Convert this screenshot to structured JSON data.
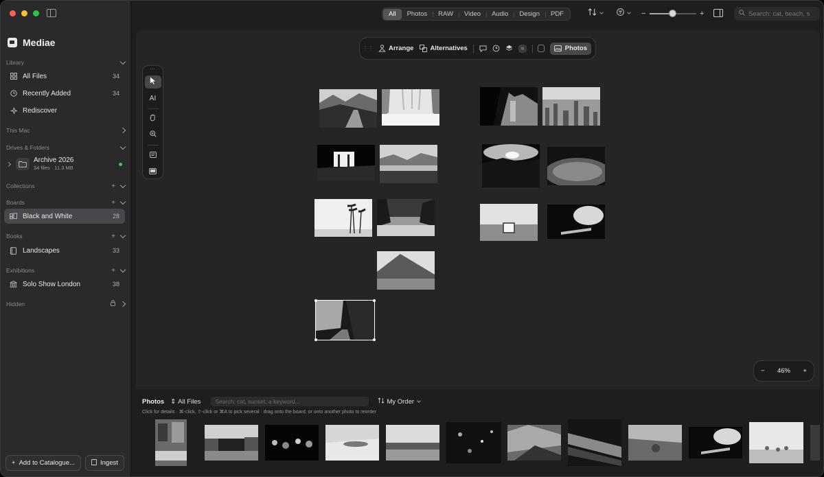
{
  "app": {
    "name": "Mediae"
  },
  "topbar": {
    "filter_tabs": [
      "All",
      "Photos",
      "RAW",
      "Video",
      "Audio",
      "Design",
      "PDF"
    ],
    "selected_filter": "All",
    "search_placeholder": "Search: cat, beach, s",
    "zoom_level": 0.48
  },
  "sidebar": {
    "library": {
      "header": "Library",
      "items": [
        {
          "label": "All Files",
          "count": "34",
          "icon": "grid-icon"
        },
        {
          "label": "Recently Added",
          "count": "34",
          "icon": "clock-icon"
        },
        {
          "label": "Rediscover",
          "count": "",
          "icon": "sparkle-icon"
        }
      ]
    },
    "this_mac": {
      "header": "This Mac"
    },
    "drives": {
      "header": "Drives & Folders",
      "drive_name": "Archive 2026",
      "drive_info": "34 files · 11.3 MB",
      "status_color": "#30d158"
    },
    "collections": {
      "header": "Collections"
    },
    "boards": {
      "header": "Boards",
      "item": {
        "label": "Black and White",
        "count": "28"
      }
    },
    "books": {
      "header": "Books",
      "item": {
        "label": "Landscapes",
        "count": "33"
      }
    },
    "exhibitions": {
      "header": "Exhibitions",
      "item": {
        "label": "Solo Show London",
        "count": "38"
      }
    },
    "hidden": {
      "header": "Hidden"
    },
    "buttons": {
      "add": "Add to Catalogue...",
      "ingest": "Ingest"
    }
  },
  "canvas": {
    "toolbar": {
      "arrange": "Arrange",
      "alternatives": "Alternatives",
      "photos": "Photos"
    },
    "zoom_label": "46%",
    "zoom_minus": "−",
    "zoom_plus": "+"
  },
  "strip": {
    "title": "Photos",
    "filter": "All Files",
    "search_placeholder": "Search: cat, sunset, a keyword...",
    "order": "My Order",
    "hint": "Click for details · ⌘-click, ⇧-click or ⌘A to pick several · drag onto the board, or onto another photo to reorder"
  },
  "colors": {
    "accent_active": "#48484c",
    "background": "#1e1e1f"
  }
}
